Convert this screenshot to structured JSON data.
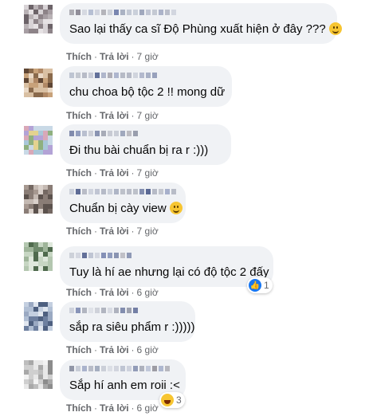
{
  "actions": {
    "like": "Thích",
    "reply": "Trả lời",
    "separator": "·"
  },
  "comments": [
    {
      "text": "Sao lại thấy ca sĩ Độ Phùng xuất hiện ở đây ???",
      "emoji": "slightly-smiling-emoji",
      "time": "7 giờ"
    },
    {
      "text": "chu choa bộ tộc 2 !! mong dữ",
      "time": "7 giờ"
    },
    {
      "text": "Đi thu bài chuẩn bị ra r :)))",
      "time": "7 giờ"
    },
    {
      "text": "Chuẩn bị cày view",
      "emoji": "smiling-emoji",
      "time": "7 giờ"
    },
    {
      "text": "Tuy là hí ae nhưng lại có độ tộc 2 đấy",
      "time": "6 giờ",
      "reaction": {
        "icon": "like-icon",
        "count": "1",
        "color": "#1877f2"
      }
    },
    {
      "text": "sắp ra siêu phẩm r :)))))",
      "time": "6 giờ"
    },
    {
      "text": "Sắp hí anh em roii :<",
      "time": "6 giờ",
      "reaction": {
        "icon": "haha-icon",
        "count": "3",
        "color": "#f7c531"
      }
    }
  ],
  "colors": {
    "bubble": "#f0f2f5",
    "meta": "#65676b",
    "text": "#050505"
  }
}
